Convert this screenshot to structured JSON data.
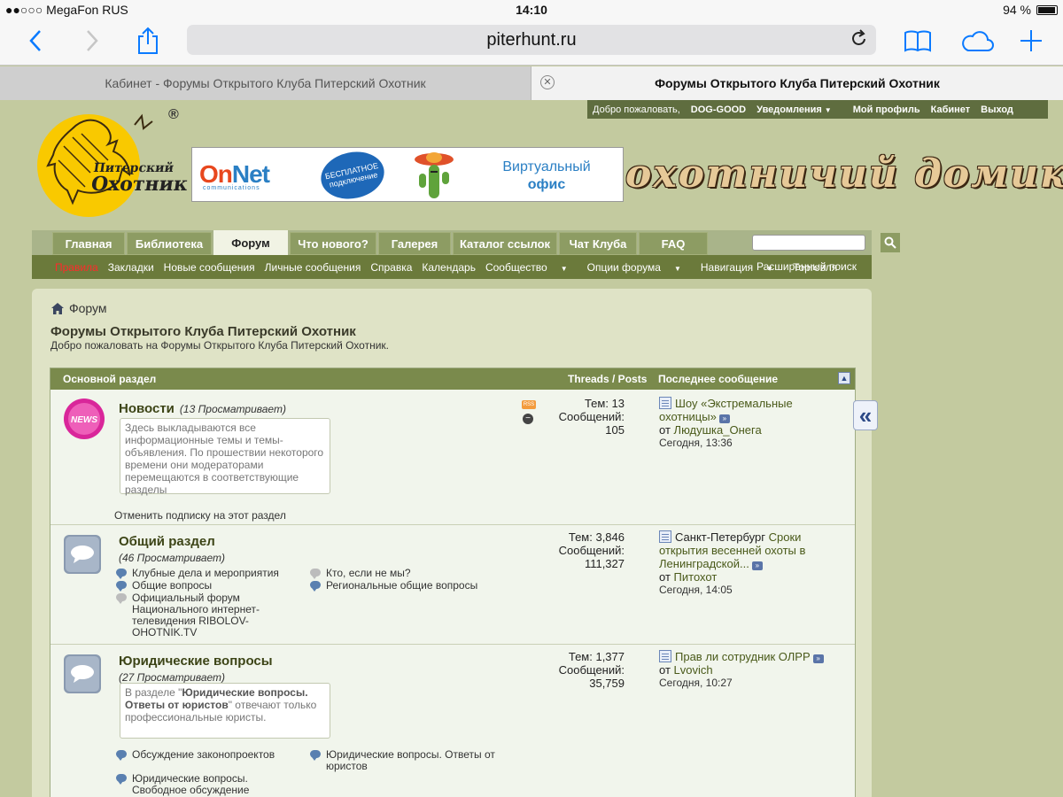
{
  "status": {
    "carrier": "●●○○○ MegaFon RUS",
    "time": "14:10",
    "battery": "94 %",
    "battery_level": 0.94
  },
  "browser": {
    "url": "piterhunt.ru",
    "tabs": [
      {
        "title": "Кабинет - Форумы Открытого Клуба Питерский Охотник"
      },
      {
        "title": "Форумы Открытого Клуба Питерский Охотник"
      }
    ]
  },
  "userbar": {
    "welcome": "Добро пожаловать,",
    "username": "DOG-GOOD",
    "notifications": "Уведомления",
    "profile": "Мой профиль",
    "cabinet": "Кабинет",
    "logout": "Выход"
  },
  "logo": {
    "text_line1": "Питерский",
    "text_line2": "Охотник",
    "registered": "®"
  },
  "banner": {
    "brand_on": "On",
    "brand_net": "Net",
    "brand_sub": "communications",
    "badge": "БЕСПЛАТНОЕ подключение",
    "virtual_line1": "Виртуальный",
    "virtual_line2": "офис"
  },
  "slogan": "охотничий домик",
  "nav": {
    "tabs": [
      "Главная",
      "Библиотека",
      "Форум",
      "Что нового?",
      "Галерея",
      "Каталог ссылок",
      "Чат Клуба",
      "FAQ"
    ],
    "active": "Форум",
    "sub": [
      "Правила",
      "Закладки",
      "Новые сообщения",
      "Личные сообщения",
      "Справка",
      "Календарь",
      "Сообщество",
      "Опции форума",
      "Навигация",
      "Торговля"
    ],
    "advanced_search": "Расширенный поиск"
  },
  "page": {
    "breadcrumb": "Форум",
    "title": "Форумы Открытого Клуба Питерский Охотник",
    "welcome": "Добро пожаловать на Форумы Открытого Клуба Питерский Охотник."
  },
  "table": {
    "section": "Основной раздел",
    "col_threads": "Threads / Posts",
    "col_last": "Последнее сообщение",
    "rss": "RSS",
    "unsubscribe": "Отменить подписку на этот раздел",
    "forums": [
      {
        "name": "Новости",
        "viewing": "(13 Просматривает)",
        "desc": "Здесь выкладываются все информационные темы и темы-объявления. По прошествии некоторого времени они модераторами перемещаются в соответствующие разделы",
        "stats": [
          "Тем: 13",
          "Сообщений:",
          "105"
        ],
        "last": {
          "title": "Шоу «Экстремальные охотницы»",
          "by": "от",
          "author": "Людушка_Онега",
          "time": "Сегодня, 13:36"
        }
      },
      {
        "name": "Общий раздел",
        "viewing": "(46 Просматривает)",
        "subforums": [
          "Клубные дела и мероприятия",
          "Общие вопросы",
          "Официальный форум Национального интернет-телевидения RIBOLOV-OHOTNIK.TV",
          "Кто, если не мы?",
          "Региональные общие вопросы"
        ],
        "stats": [
          "Тем: 3,846",
          "Сообщений:",
          "111,327"
        ],
        "last": {
          "prefix": "Санкт-Петербург",
          "title": "Сроки открытия весенней охоты в Ленинградской...",
          "by": "от",
          "author": "Питохот",
          "time": "Сегодня, 14:05"
        }
      },
      {
        "name": "Юридические вопросы",
        "viewing": "(27 Просматривает)",
        "desc_pre": "В разделе \"",
        "desc_bold": "Юридические вопросы. Ответы от юристов",
        "desc_post": "\" отвечают только профессиональные юристы.",
        "subforums": [
          "Обсуждение законопроектов",
          "Юридические вопросы. Ответы от юристов",
          "Юридические вопросы. Свободное обсуждение"
        ],
        "stats": [
          "Тем: 1,377",
          "Сообщений:",
          "35,759"
        ],
        "last": {
          "title": "Прав ли сотрудник ОЛРР",
          "by": "от",
          "author": "Lvovich",
          "time": "Сегодня, 10:27"
        }
      }
    ]
  },
  "colors": {
    "page_bg": "#c3ca9f",
    "nav_green": "#6b7a3b",
    "header_green": "#7a8a4c",
    "safari_blue": "#0a7aff",
    "rules_red": "#ff2a2a"
  },
  "icons": {
    "back": "chevron-left-icon",
    "forward": "chevron-right-icon",
    "share": "share-icon",
    "reload": "reload-icon",
    "bookmarks": "book-icon",
    "cloud": "cloud-icon",
    "new_tab": "plus-icon",
    "search": "search-icon",
    "home": "home-icon",
    "collapse": "collapse-icon",
    "sidebar": "double-chevron-left-icon"
  }
}
